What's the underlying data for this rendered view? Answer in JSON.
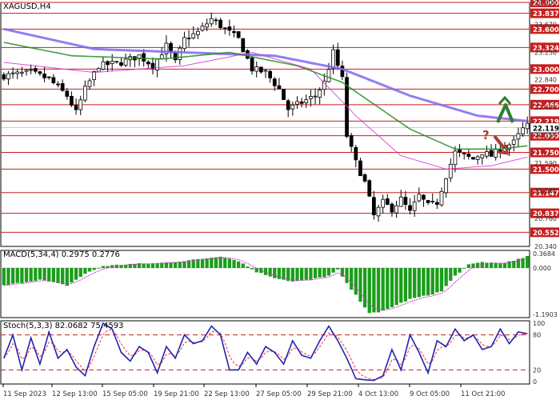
{
  "chart_data": [
    {
      "type": "candlestick",
      "title": "XAGUSD,H4",
      "ylim": [
        20.34,
        24.0
      ],
      "price_ticks": [
        24.0,
        23.67,
        23.25,
        22.84,
        22.43,
        22.01,
        21.59,
        21.18,
        20.76,
        20.34
      ],
      "price_tick_labels": [
        "24.000",
        "23.670",
        "23.250",
        "22.840",
        "22.430",
        "22.119",
        "21.590",
        "21.180",
        "20.760",
        "20.340"
      ],
      "levels": [
        24.0,
        23.837,
        23.6,
        23.324,
        23.0,
        22.7,
        22.466,
        22.219,
        22.0,
        21.75,
        21.5,
        21.147,
        20.837,
        20.552
      ],
      "level_labels": [
        "24.000",
        "23.837",
        "23.600",
        "23.324",
        "23.000",
        "22.700",
        "22.466",
        "22.219",
        "22.000",
        "21.750",
        "21.500",
        "21.147",
        "20.837",
        "20.552"
      ],
      "current_price": 22.119,
      "current_price_label": "22.119",
      "close_keypoints": [
        [
          0,
          22.9
        ],
        [
          6,
          22.95
        ],
        [
          10,
          22.85
        ],
        [
          14,
          22.6
        ],
        [
          16,
          22.35
        ],
        [
          18,
          22.7
        ],
        [
          21,
          23.05
        ],
        [
          26,
          23.1
        ],
        [
          30,
          23.2
        ],
        [
          33,
          23.05
        ],
        [
          36,
          23.35
        ],
        [
          38,
          23.1
        ],
        [
          40,
          23.45
        ],
        [
          43,
          23.55
        ],
        [
          46,
          23.75
        ],
        [
          49,
          23.6
        ],
        [
          52,
          23.45
        ],
        [
          55,
          23.0
        ],
        [
          58,
          22.95
        ],
        [
          61,
          22.7
        ],
        [
          63,
          22.4
        ],
        [
          66,
          22.5
        ],
        [
          69,
          22.6
        ],
        [
          71,
          22.8
        ],
        [
          73,
          23.25
        ],
        [
          75,
          22.85
        ],
        [
          76,
          22.0
        ],
        [
          78,
          21.6
        ],
        [
          80,
          21.3
        ],
        [
          82,
          20.8
        ],
        [
          84,
          21.0
        ],
        [
          86,
          20.9
        ],
        [
          88,
          21.05
        ],
        [
          90,
          20.85
        ],
        [
          92,
          21.1
        ],
        [
          94,
          20.95
        ],
        [
          96,
          21.0
        ],
        [
          98,
          21.4
        ],
        [
          100,
          21.75
        ],
        [
          102,
          21.7
        ],
        [
          104,
          21.65
        ],
        [
          106,
          21.75
        ],
        [
          108,
          21.7
        ],
        [
          110,
          21.8
        ],
        [
          113,
          21.9
        ],
        [
          115,
          22.1
        ],
        [
          116,
          22.15
        ]
      ],
      "moving_averages": [
        {
          "color": "#7b68ee",
          "keypoints": [
            [
              0,
              23.6
            ],
            [
              20,
              23.3
            ],
            [
              40,
              23.25
            ],
            [
              60,
              23.2
            ],
            [
              75,
              23.0
            ],
            [
              90,
              22.6
            ],
            [
              105,
              22.3
            ],
            [
              116,
              22.22
            ]
          ]
        },
        {
          "color": "#228b22",
          "keypoints": [
            [
              0,
              23.4
            ],
            [
              15,
              23.2
            ],
            [
              35,
              23.15
            ],
            [
              50,
              23.25
            ],
            [
              65,
              23.05
            ],
            [
              75,
              22.8
            ],
            [
              90,
              22.1
            ],
            [
              100,
              21.8
            ],
            [
              110,
              21.8
            ],
            [
              116,
              21.85
            ]
          ]
        },
        {
          "color": "#d633d6",
          "keypoints": [
            [
              0,
              23.1
            ],
            [
              20,
              22.95
            ],
            [
              40,
              23.05
            ],
            [
              55,
              23.25
            ],
            [
              68,
              23.0
            ],
            [
              78,
              22.3
            ],
            [
              88,
              21.7
            ],
            [
              98,
              21.5
            ],
            [
              108,
              21.55
            ],
            [
              116,
              21.68
            ]
          ]
        }
      ],
      "forecast_annotation": {
        "symbol": "?",
        "up_arrow_color": "#2e7d32",
        "down_arrow_color": "#b03a2e"
      }
    },
    {
      "type": "histogram",
      "title": "MACD(5,34,4) 0.2975 0.2776",
      "ylim": [
        -1.1903,
        0.3684
      ],
      "tick_labels": [
        "0.3684",
        "0.000",
        "-1.1903"
      ],
      "histogram_keypoints": [
        [
          0,
          -0.45
        ],
        [
          8,
          -0.3
        ],
        [
          14,
          -0.45
        ],
        [
          18,
          -0.15
        ],
        [
          22,
          0.05
        ],
        [
          28,
          0.1
        ],
        [
          34,
          0.12
        ],
        [
          40,
          0.18
        ],
        [
          45,
          0.25
        ],
        [
          48,
          0.3
        ],
        [
          52,
          0.18
        ],
        [
          56,
          -0.1
        ],
        [
          60,
          -0.25
        ],
        [
          64,
          -0.35
        ],
        [
          68,
          -0.3
        ],
        [
          72,
          -0.2
        ],
        [
          74,
          -0.05
        ],
        [
          76,
          -0.4
        ],
        [
          79,
          -0.85
        ],
        [
          81,
          -1.15
        ],
        [
          83,
          -1.15
        ],
        [
          86,
          -1.0
        ],
        [
          90,
          -0.8
        ],
        [
          94,
          -0.7
        ],
        [
          97,
          -0.6
        ],
        [
          100,
          -0.2
        ],
        [
          103,
          0.08
        ],
        [
          106,
          0.15
        ],
        [
          110,
          0.12
        ],
        [
          113,
          0.18
        ],
        [
          116,
          0.3
        ]
      ],
      "signal_color": "#d633d6"
    },
    {
      "type": "line",
      "title": "Stoch(5,3,3) 82.0682 75.4593",
      "ylim": [
        0,
        100
      ],
      "tick_labels": [
        "100",
        "80",
        "20",
        "0"
      ],
      "reference_levels": [
        80,
        20
      ],
      "main_keypoints": [
        [
          0,
          40
        ],
        [
          2,
          80
        ],
        [
          4,
          20
        ],
        [
          6,
          75
        ],
        [
          8,
          30
        ],
        [
          10,
          85
        ],
        [
          12,
          40
        ],
        [
          14,
          55
        ],
        [
          16,
          25
        ],
        [
          18,
          10
        ],
        [
          20,
          60
        ],
        [
          22,
          100
        ],
        [
          24,
          90
        ],
        [
          26,
          50
        ],
        [
          28,
          35
        ],
        [
          30,
          60
        ],
        [
          32,
          50
        ],
        [
          34,
          15
        ],
        [
          36,
          60
        ],
        [
          38,
          40
        ],
        [
          40,
          80
        ],
        [
          42,
          65
        ],
        [
          44,
          70
        ],
        [
          46,
          95
        ],
        [
          48,
          80
        ],
        [
          50,
          20
        ],
        [
          52,
          20
        ],
        [
          54,
          50
        ],
        [
          56,
          30
        ],
        [
          58,
          60
        ],
        [
          60,
          50
        ],
        [
          62,
          30
        ],
        [
          64,
          70
        ],
        [
          66,
          45
        ],
        [
          68,
          40
        ],
        [
          70,
          70
        ],
        [
          72,
          95
        ],
        [
          74,
          70
        ],
        [
          76,
          40
        ],
        [
          78,
          5
        ],
        [
          80,
          3
        ],
        [
          82,
          2
        ],
        [
          84,
          10
        ],
        [
          86,
          55
        ],
        [
          88,
          20
        ],
        [
          90,
          80
        ],
        [
          92,
          50
        ],
        [
          94,
          15
        ],
        [
          96,
          70
        ],
        [
          98,
          60
        ],
        [
          100,
          90
        ],
        [
          102,
          70
        ],
        [
          104,
          80
        ],
        [
          106,
          55
        ],
        [
          108,
          60
        ],
        [
          110,
          90
        ],
        [
          112,
          65
        ],
        [
          114,
          85
        ],
        [
          116,
          82
        ]
      ],
      "main_color": "#2323b0",
      "signal_color": "#ff3030"
    }
  ],
  "time_axis": {
    "labels": [
      "11 Sep 2023",
      "12 Sep 13:00",
      "15 Sep 05:00",
      "19 Sep 21:00",
      "22 Sep 13:00",
      "27 Sep 05:00",
      "29 Sep 21:00",
      "4 Oct 13:00",
      "9 Oct 05:00",
      "11 Oct 21:00"
    ]
  }
}
